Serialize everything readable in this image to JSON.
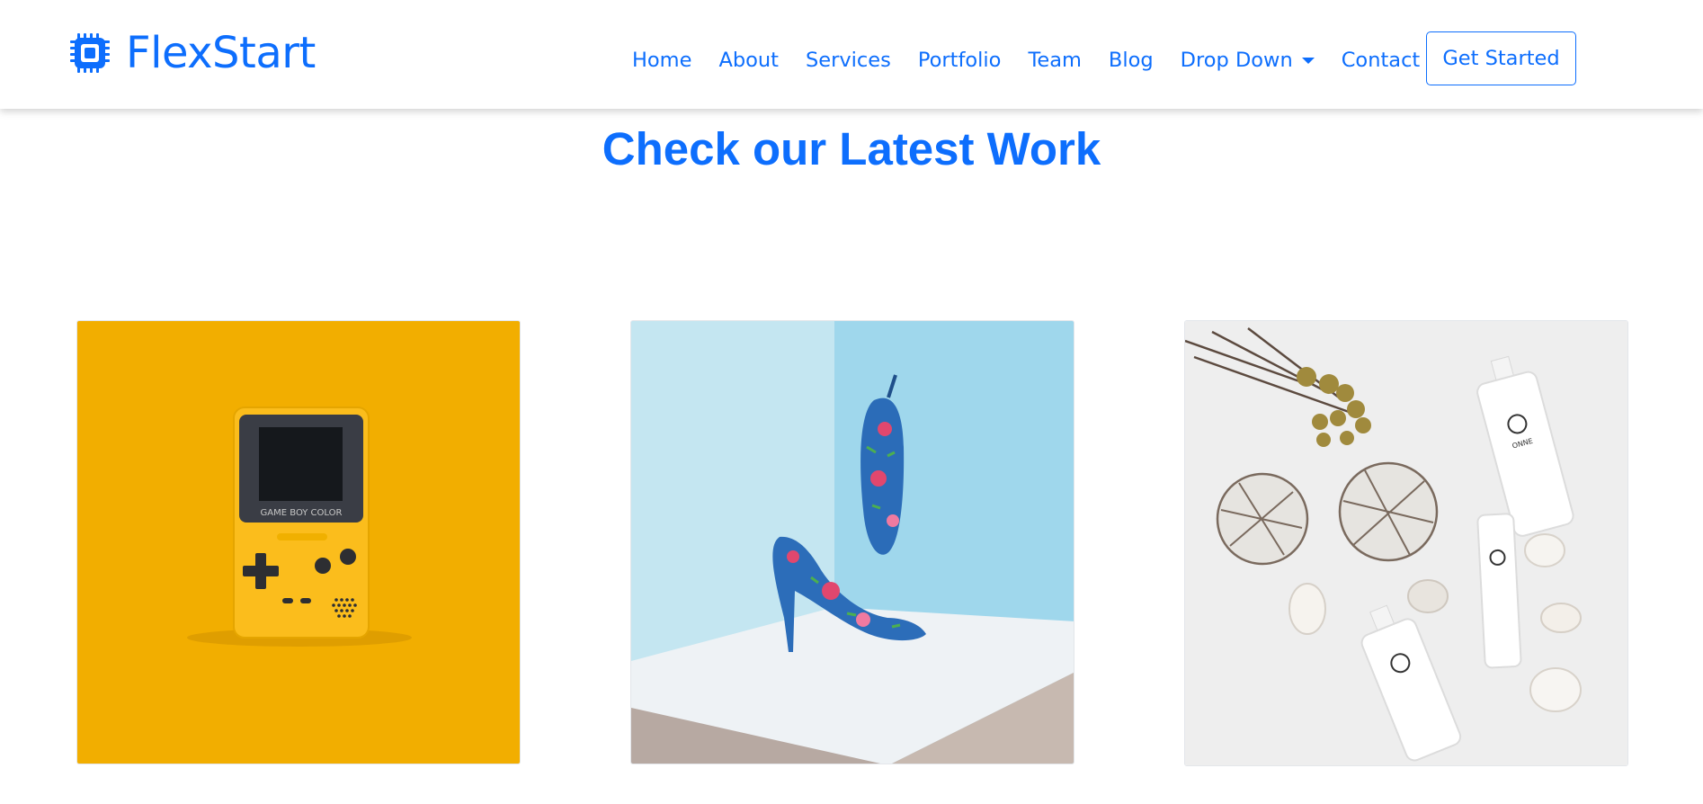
{
  "brand": {
    "name": "FlexStart",
    "icon": "chip-icon",
    "color": "#0d6efd"
  },
  "nav": {
    "items": [
      {
        "label": "Home",
        "name": "nav-home"
      },
      {
        "label": "About",
        "name": "nav-about"
      },
      {
        "label": "Services",
        "name": "nav-services"
      },
      {
        "label": "Portfolio",
        "name": "nav-portfolio"
      },
      {
        "label": "Team",
        "name": "nav-team"
      },
      {
        "label": "Blog",
        "name": "nav-blog"
      },
      {
        "label": "Drop Down",
        "name": "nav-dropdown",
        "icon": "caret-down-icon"
      },
      {
        "label": "Contact",
        "name": "nav-contact"
      }
    ],
    "cta": "Get Started"
  },
  "section": {
    "title": "Check our Latest Work"
  },
  "portfolio": {
    "items": [
      {
        "subject": "yellow handheld game console",
        "background": "#f2ae00",
        "device_label": "GAME BOY COLOR"
      },
      {
        "subject": "floral high heel shoes",
        "background": "#a9dbec"
      },
      {
        "subject": "skincare bottles with shells",
        "background": "#eeeeee",
        "bottle_label": "ONNE"
      }
    ]
  }
}
